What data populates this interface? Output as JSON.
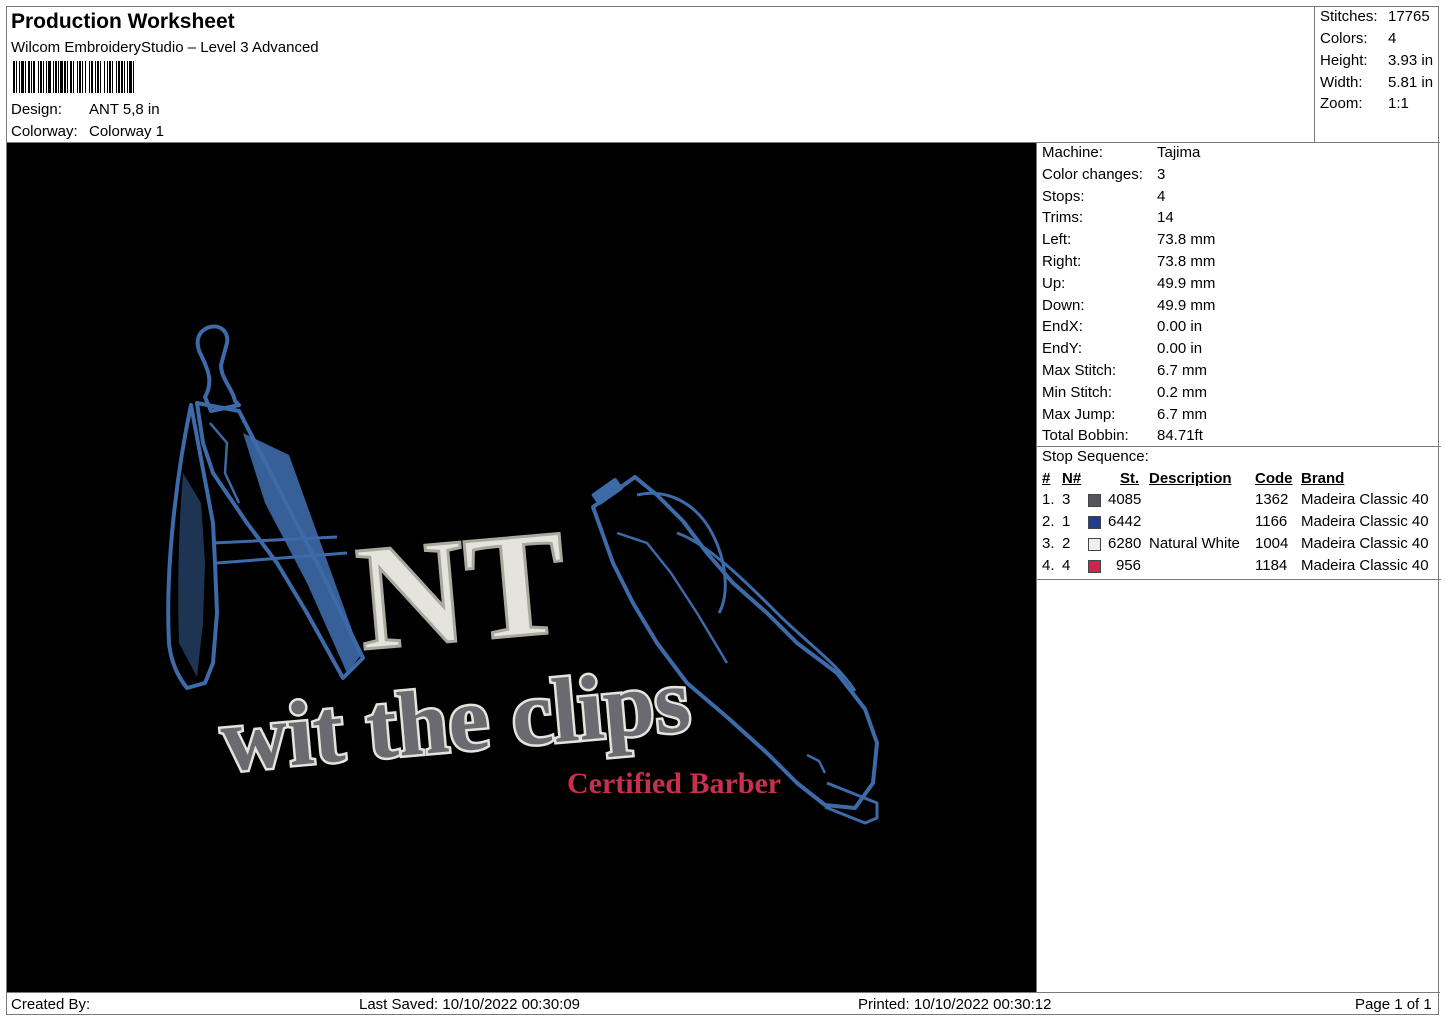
{
  "header": {
    "title": "Production Worksheet",
    "software": "Wilcom EmbroideryStudio – Level 3 Advanced",
    "design_label": "Design:",
    "design_value": "ANT 5,8 in",
    "colorway_label": "Colorway:",
    "colorway_value": "Colorway 1"
  },
  "summary": {
    "stitches_label": "Stitches:",
    "stitches_value": "17765",
    "colors_label": "Colors:",
    "colors_value": "4",
    "height_label": "Height:",
    "height_value": "3.93 in",
    "width_label": "Width:",
    "width_value": "5.81 in",
    "zoom_label": "Zoom:",
    "zoom_value": "1:1"
  },
  "machine_info": [
    {
      "label": "Machine:",
      "value": "Tajima"
    },
    {
      "label": "Color changes:",
      "value": "3"
    },
    {
      "label": "Stops:",
      "value": "4"
    },
    {
      "label": "Trims:",
      "value": "14"
    },
    {
      "label": "Left:",
      "value": "73.8 mm"
    },
    {
      "label": "Right:",
      "value": "73.8 mm"
    },
    {
      "label": "Up:",
      "value": "49.9 mm"
    },
    {
      "label": "Down:",
      "value": "49.9 mm"
    },
    {
      "label": "EndX:",
      "value": "0.00 in"
    },
    {
      "label": "EndY:",
      "value": "0.00 in"
    },
    {
      "label": "Max Stitch:",
      "value": "6.7 mm"
    },
    {
      "label": "Min Stitch:",
      "value": "0.2 mm"
    },
    {
      "label": "Max Jump:",
      "value": "6.7 mm"
    },
    {
      "label": "Total Bobbin:",
      "value": "84.71ft"
    }
  ],
  "stop_sequence": {
    "title": "Stop Sequence:",
    "headers": {
      "num": "#",
      "n": "N#",
      "st": "St.",
      "description": "Description",
      "code": "Code",
      "brand": "Brand"
    },
    "rows": [
      {
        "num": "1.",
        "n": "3",
        "color": "#55565c",
        "st": "4085",
        "description": "",
        "code": "1362",
        "brand": "Madeira Classic 40"
      },
      {
        "num": "2.",
        "n": "1",
        "color": "#1f3f8a",
        "st": "6442",
        "description": "",
        "code": "1166",
        "brand": "Madeira Classic 40"
      },
      {
        "num": "3.",
        "n": "2",
        "color": "#eeeeee",
        "st": "6280",
        "description": "Natural White",
        "code": "1004",
        "brand": "Madeira Classic 40"
      },
      {
        "num": "4.",
        "n": "4",
        "color": "#c8264a",
        "st": "956",
        "description": "",
        "code": "1184",
        "brand": "Madeira Classic 40"
      }
    ]
  },
  "design": {
    "line1": "NT",
    "line2": "wit the clips",
    "line3": "Certified Barber",
    "colors": {
      "blue": "#3d6aa8",
      "white": "#e4e4dc",
      "gray": "#6a6a70",
      "red": "#c8314e",
      "background": "#000000"
    }
  },
  "footer": {
    "created_by": "Created By:",
    "last_saved": "Last Saved: 10/10/2022 00:30:09",
    "printed": "Printed: 10/10/2022 00:30:12",
    "page": "Page 1 of 1"
  }
}
